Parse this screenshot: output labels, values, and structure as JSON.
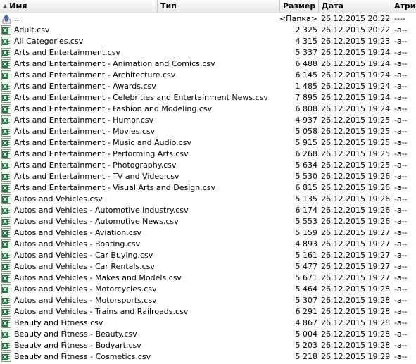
{
  "columns": {
    "name": "Имя",
    "type": "Тип",
    "size": "Размер",
    "date": "Дата",
    "attr": "Атри"
  },
  "rows": [
    {
      "name": "..",
      "size": "<Папка>",
      "date": "26.12.2015 20:22",
      "attr": "----",
      "icon": "up-folder-icon"
    },
    {
      "name": "Adult.csv",
      "size": "2 325",
      "date": "26.12.2015 20:22",
      "attr": "-a--",
      "icon": "excel-csv-icon"
    },
    {
      "name": "All Categories.csv",
      "size": "4 315",
      "date": "26.12.2015 19:23",
      "attr": "-a--",
      "icon": "excel-csv-icon"
    },
    {
      "name": "Arts and Entertainment.csv",
      "size": "5 337",
      "date": "26.12.2015 19:24",
      "attr": "-a--",
      "icon": "excel-csv-icon"
    },
    {
      "name": "Arts and Entertainment - Animation and Comics.csv",
      "size": "6 488",
      "date": "26.12.2015 19:24",
      "attr": "-a--",
      "icon": "excel-csv-icon"
    },
    {
      "name": "Arts and Entertainment - Architecture.csv",
      "size": "6 145",
      "date": "26.12.2015 19:24",
      "attr": "-a--",
      "icon": "excel-csv-icon"
    },
    {
      "name": "Arts and Entertainment - Awards.csv",
      "size": "1 485",
      "date": "26.12.2015 19:24",
      "attr": "-a--",
      "icon": "excel-csv-icon"
    },
    {
      "name": "Arts and Entertainment - Celebrities and Entertainment News.csv",
      "size": "7 895",
      "date": "26.12.2015 19:24",
      "attr": "-a--",
      "icon": "excel-csv-icon"
    },
    {
      "name": "Arts and Entertainment - Fashion and Modeling.csv",
      "size": "6 808",
      "date": "26.12.2015 19:24",
      "attr": "-a--",
      "icon": "excel-csv-icon"
    },
    {
      "name": "Arts and Entertainment - Humor.csv",
      "size": "4 937",
      "date": "26.12.2015 19:25",
      "attr": "-a--",
      "icon": "excel-csv-icon"
    },
    {
      "name": "Arts and Entertainment - Movies.csv",
      "size": "5 058",
      "date": "26.12.2015 19:25",
      "attr": "-a--",
      "icon": "excel-csv-icon"
    },
    {
      "name": "Arts and Entertainment - Music and Audio.csv",
      "size": "5 915",
      "date": "26.12.2015 19:25",
      "attr": "-a--",
      "icon": "excel-csv-icon"
    },
    {
      "name": "Arts and Entertainment - Performing Arts.csv",
      "size": "6 268",
      "date": "26.12.2015 19:25",
      "attr": "-a--",
      "icon": "excel-csv-icon"
    },
    {
      "name": "Arts and Entertainment - Photography.csv",
      "size": "5 634",
      "date": "26.12.2015 19:25",
      "attr": "-a--",
      "icon": "excel-csv-icon"
    },
    {
      "name": "Arts and Entertainment - TV and Video.csv",
      "size": "5 530",
      "date": "26.12.2015 19:26",
      "attr": "-a--",
      "icon": "excel-csv-icon"
    },
    {
      "name": "Arts and Entertainment - Visual Arts and Design.csv",
      "size": "6 815",
      "date": "26.12.2015 19:26",
      "attr": "-a--",
      "icon": "excel-csv-icon"
    },
    {
      "name": "Autos and Vehicles.csv",
      "size": "5 135",
      "date": "26.12.2015 19:26",
      "attr": "-a--",
      "icon": "excel-csv-icon"
    },
    {
      "name": "Autos and Vehicles - Automotive Industry.csv",
      "size": "6 174",
      "date": "26.12.2015 19:26",
      "attr": "-a--",
      "icon": "excel-csv-icon"
    },
    {
      "name": "Autos and Vehicles - Automotive News.csv",
      "size": "5 553",
      "date": "26.12.2015 19:26",
      "attr": "-a--",
      "icon": "excel-csv-icon"
    },
    {
      "name": "Autos and Vehicles - Aviation.csv",
      "size": "5 159",
      "date": "26.12.2015 19:27",
      "attr": "-a--",
      "icon": "excel-csv-icon"
    },
    {
      "name": "Autos and Vehicles - Boating.csv",
      "size": "4 893",
      "date": "26.12.2015 19:27",
      "attr": "-a--",
      "icon": "excel-csv-icon"
    },
    {
      "name": "Autos and Vehicles - Car Buying.csv",
      "size": "5 161",
      "date": "26.12.2015 19:27",
      "attr": "-a--",
      "icon": "excel-csv-icon"
    },
    {
      "name": "Autos and Vehicles - Car Rentals.csv",
      "size": "5 477",
      "date": "26.12.2015 19:27",
      "attr": "-a--",
      "icon": "excel-csv-icon"
    },
    {
      "name": "Autos and Vehicles - Makes and Models.csv",
      "size": "5 671",
      "date": "26.12.2015 19:27",
      "attr": "-a--",
      "icon": "excel-csv-icon"
    },
    {
      "name": "Autos and Vehicles - Motorcycles.csv",
      "size": "5 464",
      "date": "26.12.2015 19:28",
      "attr": "-a--",
      "icon": "excel-csv-icon"
    },
    {
      "name": "Autos and Vehicles - Motorsports.csv",
      "size": "5 307",
      "date": "26.12.2015 19:28",
      "attr": "-a--",
      "icon": "excel-csv-icon"
    },
    {
      "name": "Autos and Vehicles - Trains and Railroads.csv",
      "size": "6 291",
      "date": "26.12.2015 19:28",
      "attr": "-a--",
      "icon": "excel-csv-icon"
    },
    {
      "name": "Beauty and Fitness.csv",
      "size": "4 867",
      "date": "26.12.2015 19:28",
      "attr": "-a--",
      "icon": "excel-csv-icon"
    },
    {
      "name": "Beauty and Fitness - Beauty.csv",
      "size": "5 004",
      "date": "26.12.2015 19:28",
      "attr": "-a--",
      "icon": "excel-csv-icon"
    },
    {
      "name": "Beauty and Fitness - Bodyart.csv",
      "size": "5 203",
      "date": "26.12.2015 19:28",
      "attr": "-a--",
      "icon": "excel-csv-icon"
    },
    {
      "name": "Beauty and Fitness - Cosmetics.csv",
      "size": "5 218",
      "date": "26.12.2015 19:29",
      "attr": "-a--",
      "icon": "excel-csv-icon"
    }
  ]
}
